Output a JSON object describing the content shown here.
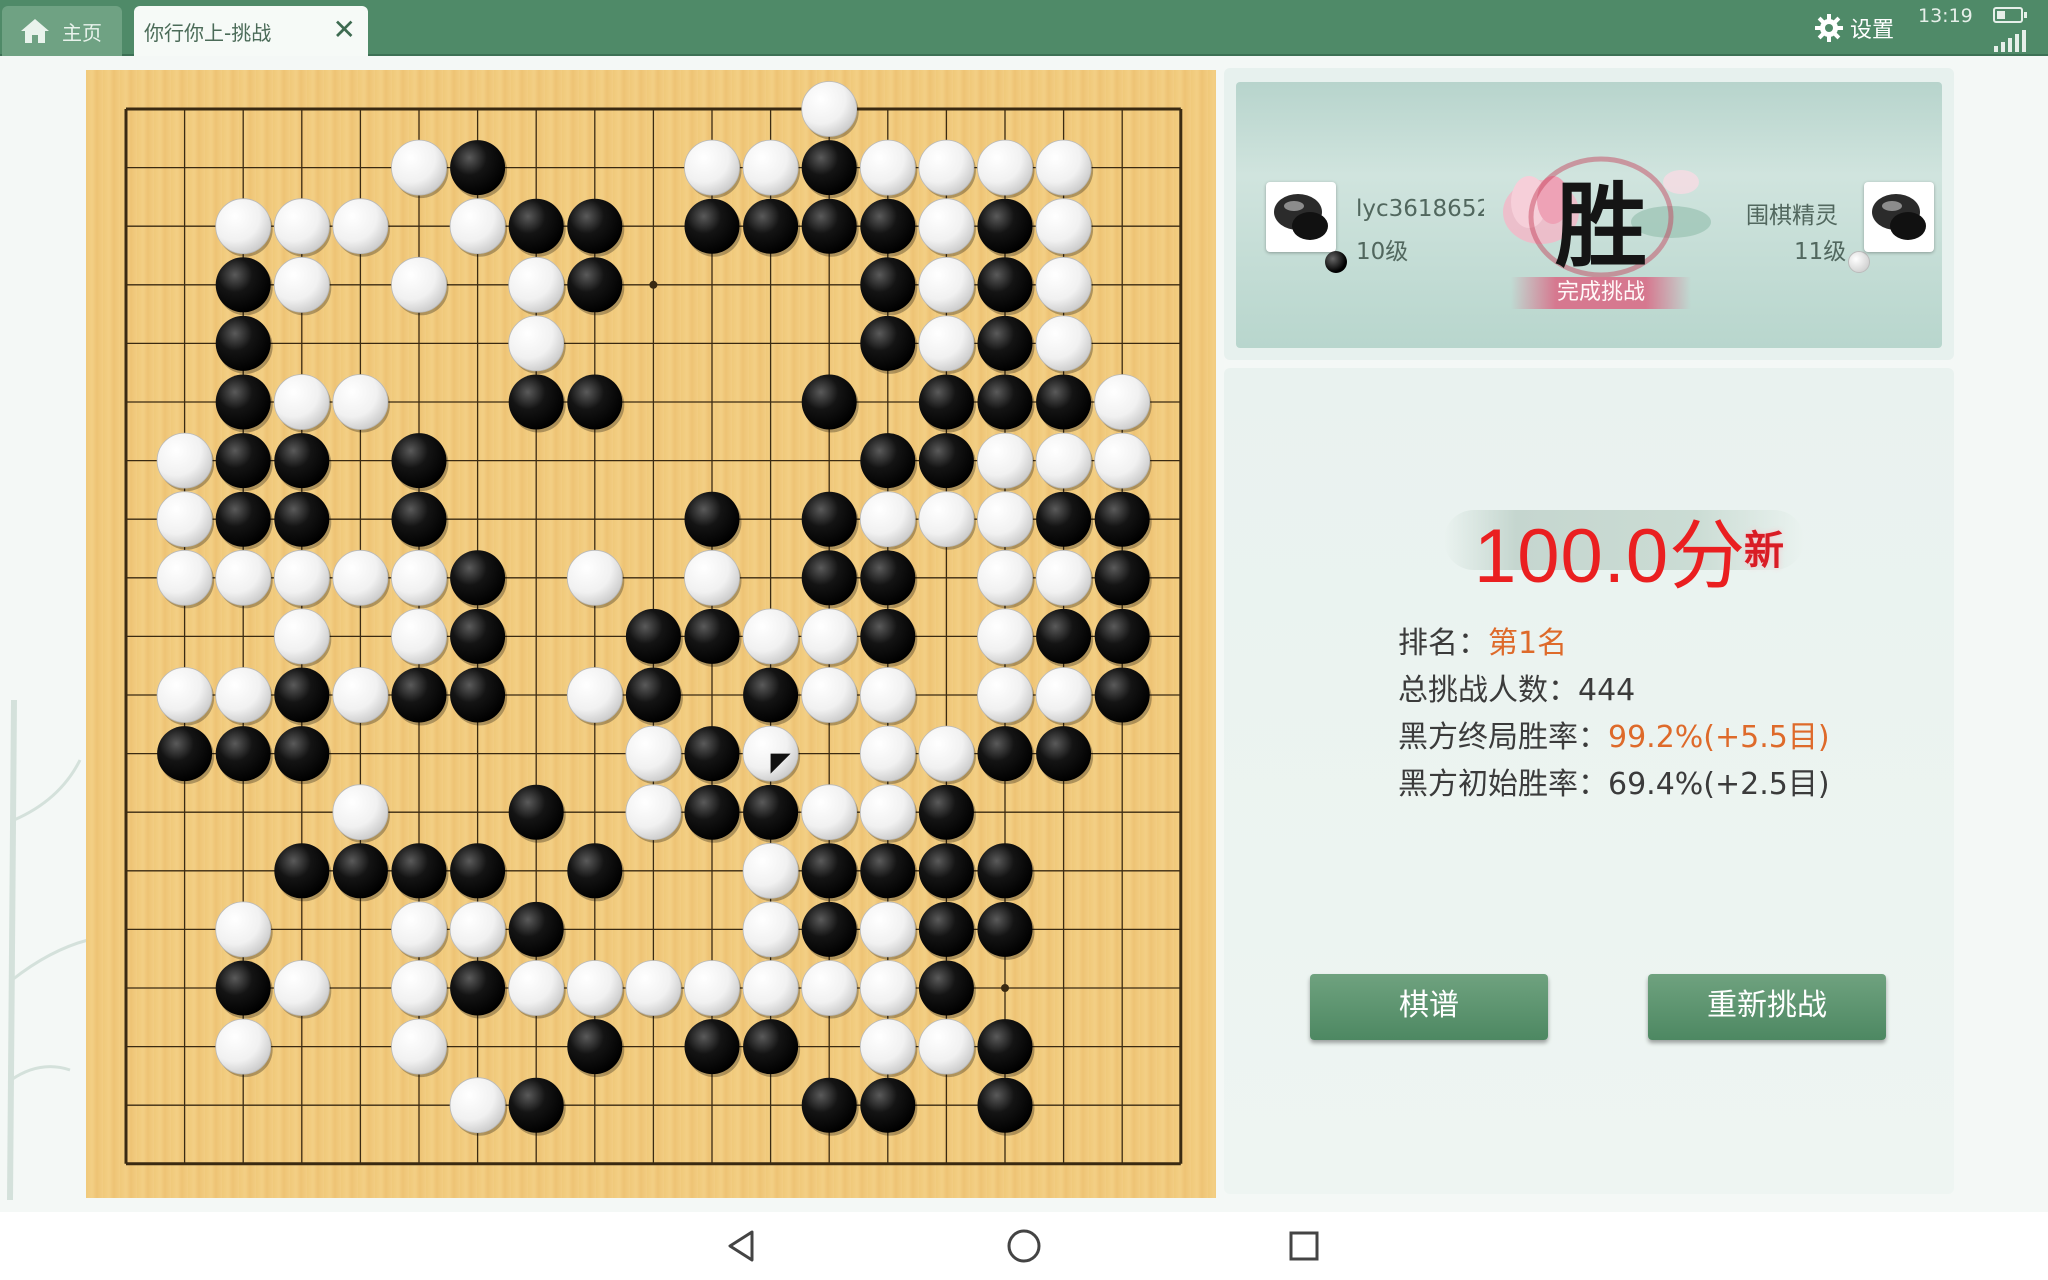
{
  "topbar": {
    "home_tab_label": "主页",
    "challenge_tab_label": "你行你上-挑战",
    "close_symbol": "✕",
    "settings_label": "设置",
    "clock": "13:19",
    "icons": [
      "home-icon",
      "close-icon",
      "gear-icon",
      "battery-icon",
      "signal-icon"
    ]
  },
  "board": {
    "size": 19,
    "colors": {
      "wood": "#f0c97a",
      "line": "#3a2a12",
      "black_stone": "#111111",
      "white_stone": "#f5f5f5"
    },
    "last_move_marker": "black-triangle",
    "rows": [
      "...........W.......",
      "....WB...WWBWWWW...",
      "..WWWWBB.BBBBWBW...",
      "..BW.W.WB.....BWBW.",
      "..B......W.....BWBW",
      "..BWW.....BB..B.BBBW",
      ".WBB.B........BBWWW",
      ".WBB.B....B.BWWWBBB",
      ".WWWWWBW.W.BB.WWB.",
      "...W.WB..BBWWB..WBB",
      ".WWBWBB.WB.BWW..WWB",
      ".BBB.......WB.WWBB.",
      "....W..B..W.BBWWB..",
      "...BBBB.B...WBBBB..",
      "..W..WWB....WBWBB..",
      "..BW..WBWWWWWWWB...",
      "..W..W...B..BB.WWB.",
      ".......WB.....BB.B.",
      "..................."
    ],
    "stones": [
      {
        "c": "W",
        "x": 12,
        "y": 0
      },
      {
        "c": "W",
        "x": 5,
        "y": 1
      },
      {
        "c": "B",
        "x": 6,
        "y": 1
      },
      {
        "c": "W",
        "x": 10,
        "y": 1
      },
      {
        "c": "W",
        "x": 11,
        "y": 1
      },
      {
        "c": "B",
        "x": 12,
        "y": 1
      },
      {
        "c": "W",
        "x": 13,
        "y": 1
      },
      {
        "c": "W",
        "x": 14,
        "y": 1
      },
      {
        "c": "W",
        "x": 15,
        "y": 1
      },
      {
        "c": "W",
        "x": 16,
        "y": 1
      },
      {
        "c": "W",
        "x": 2,
        "y": 2
      },
      {
        "c": "W",
        "x": 3,
        "y": 2
      },
      {
        "c": "W",
        "x": 4,
        "y": 2
      },
      {
        "c": "W",
        "x": 6,
        "y": 2
      },
      {
        "c": "B",
        "x": 7,
        "y": 2
      },
      {
        "c": "B",
        "x": 8,
        "y": 2
      },
      {
        "c": "B",
        "x": 10,
        "y": 2
      },
      {
        "c": "B",
        "x": 11,
        "y": 2
      },
      {
        "c": "B",
        "x": 12,
        "y": 2
      },
      {
        "c": "B",
        "x": 13,
        "y": 2
      },
      {
        "c": "W",
        "x": 14,
        "y": 2
      },
      {
        "c": "B",
        "x": 15,
        "y": 2
      },
      {
        "c": "W",
        "x": 16,
        "y": 2
      },
      {
        "c": "B",
        "x": 2,
        "y": 3
      },
      {
        "c": "W",
        "x": 3,
        "y": 3
      },
      {
        "c": "W",
        "x": 5,
        "y": 3
      },
      {
        "c": "W",
        "x": 7,
        "y": 3
      },
      {
        "c": "B",
        "x": 8,
        "y": 3
      },
      {
        "c": "B",
        "x": 13,
        "y": 3
      },
      {
        "c": "W",
        "x": 14,
        "y": 3
      },
      {
        "c": "B",
        "x": 15,
        "y": 3
      },
      {
        "c": "W",
        "x": 16,
        "y": 3
      },
      {
        "c": "B",
        "x": 2,
        "y": 4
      },
      {
        "c": "W",
        "x": 7,
        "y": 4
      },
      {
        "c": "B",
        "x": 13,
        "y": 4
      },
      {
        "c": "W",
        "x": 14,
        "y": 4
      },
      {
        "c": "B",
        "x": 15,
        "y": 4
      },
      {
        "c": "W",
        "x": 16,
        "y": 4
      },
      {
        "c": "B",
        "x": 2,
        "y": 5
      },
      {
        "c": "W",
        "x": 3,
        "y": 5
      },
      {
        "c": "W",
        "x": 4,
        "y": 5
      },
      {
        "c": "B",
        "x": 7,
        "y": 5
      },
      {
        "c": "B",
        "x": 8,
        "y": 5
      },
      {
        "c": "B",
        "x": 12,
        "y": 5
      },
      {
        "c": "B",
        "x": 14,
        "y": 5
      },
      {
        "c": "B",
        "x": 15,
        "y": 5
      },
      {
        "c": "B",
        "x": 16,
        "y": 5
      },
      {
        "c": "W",
        "x": 17,
        "y": 5
      },
      {
        "c": "W",
        "x": 1,
        "y": 6
      },
      {
        "c": "B",
        "x": 2,
        "y": 6
      },
      {
        "c": "B",
        "x": 3,
        "y": 6
      },
      {
        "c": "B",
        "x": 5,
        "y": 6
      },
      {
        "c": "B",
        "x": 13,
        "y": 6
      },
      {
        "c": "B",
        "x": 14,
        "y": 6
      },
      {
        "c": "W",
        "x": 15,
        "y": 6
      },
      {
        "c": "W",
        "x": 16,
        "y": 6
      },
      {
        "c": "W",
        "x": 17,
        "y": 6
      },
      {
        "c": "W",
        "x": 1,
        "y": 7
      },
      {
        "c": "B",
        "x": 2,
        "y": 7
      },
      {
        "c": "B",
        "x": 3,
        "y": 7
      },
      {
        "c": "B",
        "x": 5,
        "y": 7
      },
      {
        "c": "B",
        "x": 10,
        "y": 7
      },
      {
        "c": "B",
        "x": 12,
        "y": 7
      },
      {
        "c": "W",
        "x": 13,
        "y": 7
      },
      {
        "c": "W",
        "x": 14,
        "y": 7
      },
      {
        "c": "W",
        "x": 15,
        "y": 7
      },
      {
        "c": "B",
        "x": 16,
        "y": 7
      },
      {
        "c": "B",
        "x": 17,
        "y": 7
      },
      {
        "c": "W",
        "x": 1,
        "y": 8
      },
      {
        "c": "W",
        "x": 2,
        "y": 8
      },
      {
        "c": "W",
        "x": 3,
        "y": 8
      },
      {
        "c": "W",
        "x": 4,
        "y": 8
      },
      {
        "c": "W",
        "x": 5,
        "y": 8
      },
      {
        "c": "B",
        "x": 6,
        "y": 8
      },
      {
        "c": "W",
        "x": 8,
        "y": 8
      },
      {
        "c": "W",
        "x": 10,
        "y": 8
      },
      {
        "c": "B",
        "x": 12,
        "y": 8
      },
      {
        "c": "B",
        "x": 13,
        "y": 8
      },
      {
        "c": "W",
        "x": 15,
        "y": 8
      },
      {
        "c": "W",
        "x": 16,
        "y": 8
      },
      {
        "c": "B",
        "x": 17,
        "y": 8
      },
      {
        "c": "W",
        "x": 3,
        "y": 9
      },
      {
        "c": "W",
        "x": 5,
        "y": 9
      },
      {
        "c": "B",
        "x": 6,
        "y": 9
      },
      {
        "c": "B",
        "x": 9,
        "y": 9
      },
      {
        "c": "B",
        "x": 10,
        "y": 9
      },
      {
        "c": "W",
        "x": 11,
        "y": 9
      },
      {
        "c": "W",
        "x": 12,
        "y": 9
      },
      {
        "c": "B",
        "x": 13,
        "y": 9
      },
      {
        "c": "W",
        "x": 15,
        "y": 9
      },
      {
        "c": "B",
        "x": 16,
        "y": 9
      },
      {
        "c": "B",
        "x": 17,
        "y": 9
      },
      {
        "c": "W",
        "x": 1,
        "y": 10
      },
      {
        "c": "W",
        "x": 2,
        "y": 10
      },
      {
        "c": "B",
        "x": 3,
        "y": 10
      },
      {
        "c": "W",
        "x": 4,
        "y": 10
      },
      {
        "c": "B",
        "x": 5,
        "y": 10
      },
      {
        "c": "B",
        "x": 6,
        "y": 10
      },
      {
        "c": "W",
        "x": 8,
        "y": 10
      },
      {
        "c": "B",
        "x": 9,
        "y": 10
      },
      {
        "c": "B",
        "x": 11,
        "y": 10
      },
      {
        "c": "W",
        "x": 12,
        "y": 10
      },
      {
        "c": "W",
        "x": 13,
        "y": 10
      },
      {
        "c": "W",
        "x": 15,
        "y": 10
      },
      {
        "c": "W",
        "x": 16,
        "y": 10
      },
      {
        "c": "B",
        "x": 17,
        "y": 10
      },
      {
        "c": "B",
        "x": 1,
        "y": 11
      },
      {
        "c": "B",
        "x": 2,
        "y": 11
      },
      {
        "c": "B",
        "x": 3,
        "y": 11
      },
      {
        "c": "W",
        "x": 9,
        "y": 11
      },
      {
        "c": "B",
        "x": 10,
        "y": 11
      },
      {
        "c": "W",
        "x": 11,
        "y": 11
      },
      {
        "c": "W",
        "x": 13,
        "y": 11
      },
      {
        "c": "W",
        "x": 14,
        "y": 11
      },
      {
        "c": "B",
        "x": 15,
        "y": 11
      },
      {
        "c": "B",
        "x": 16,
        "y": 11
      },
      {
        "c": "W",
        "x": 4,
        "y": 12
      },
      {
        "c": "B",
        "x": 7,
        "y": 12
      },
      {
        "c": "W",
        "x": 9,
        "y": 12
      },
      {
        "c": "B",
        "x": 10,
        "y": 12
      },
      {
        "c": "B",
        "x": 11,
        "y": 12
      },
      {
        "c": "W",
        "x": 12,
        "y": 12
      },
      {
        "c": "W",
        "x": 13,
        "y": 12
      },
      {
        "c": "B",
        "x": 14,
        "y": 12
      },
      {
        "c": "B",
        "x": 3,
        "y": 13
      },
      {
        "c": "B",
        "x": 4,
        "y": 13
      },
      {
        "c": "B",
        "x": 5,
        "y": 13
      },
      {
        "c": "B",
        "x": 6,
        "y": 13
      },
      {
        "c": "B",
        "x": 8,
        "y": 13
      },
      {
        "c": "W",
        "x": 11,
        "y": 13
      },
      {
        "c": "B",
        "x": 12,
        "y": 13
      },
      {
        "c": "B",
        "x": 13,
        "y": 13
      },
      {
        "c": "B",
        "x": 14,
        "y": 13
      },
      {
        "c": "B",
        "x": 15,
        "y": 13
      },
      {
        "c": "W",
        "x": 2,
        "y": 14
      },
      {
        "c": "W",
        "x": 5,
        "y": 14
      },
      {
        "c": "W",
        "x": 6,
        "y": 14
      },
      {
        "c": "B",
        "x": 7,
        "y": 14
      },
      {
        "c": "W",
        "x": 11,
        "y": 14
      },
      {
        "c": "B",
        "x": 12,
        "y": 14
      },
      {
        "c": "W",
        "x": 13,
        "y": 14
      },
      {
        "c": "B",
        "x": 14,
        "y": 14
      },
      {
        "c": "B",
        "x": 15,
        "y": 14
      },
      {
        "c": "B",
        "x": 2,
        "y": 15
      },
      {
        "c": "W",
        "x": 3,
        "y": 15
      },
      {
        "c": "W",
        "x": 5,
        "y": 15
      },
      {
        "c": "B",
        "x": 6,
        "y": 15
      },
      {
        "c": "W",
        "x": 7,
        "y": 15
      },
      {
        "c": "W",
        "x": 8,
        "y": 15
      },
      {
        "c": "W",
        "x": 9,
        "y": 15
      },
      {
        "c": "W",
        "x": 10,
        "y": 15
      },
      {
        "c": "W",
        "x": 11,
        "y": 15
      },
      {
        "c": "W",
        "x": 12,
        "y": 15
      },
      {
        "c": "W",
        "x": 13,
        "y": 15
      },
      {
        "c": "B",
        "x": 14,
        "y": 15
      },
      {
        "c": "W",
        "x": 2,
        "y": 16
      },
      {
        "c": "W",
        "x": 5,
        "y": 16
      },
      {
        "c": "B",
        "x": 8,
        "y": 16
      },
      {
        "c": "B",
        "x": 10,
        "y": 16
      },
      {
        "c": "B",
        "x": 11,
        "y": 16
      },
      {
        "c": "W",
        "x": 13,
        "y": 16
      },
      {
        "c": "W",
        "x": 14,
        "y": 16
      },
      {
        "c": "B",
        "x": 15,
        "y": 16
      },
      {
        "c": "W",
        "x": 6,
        "y": 17
      },
      {
        "c": "B",
        "x": 7,
        "y": 17
      },
      {
        "c": "B",
        "x": 12,
        "y": 17
      },
      {
        "c": "B",
        "x": 13,
        "y": 17
      },
      {
        "c": "B",
        "x": 15,
        "y": 17
      }
    ],
    "last_move": {
      "x": 11,
      "y": 11
    }
  },
  "result": {
    "win_char": "胜",
    "win_subtitle": "完成挑战",
    "player_black": {
      "name": "lyc3618652",
      "level": "10级"
    },
    "player_white": {
      "name": "围棋精灵",
      "level": "11级"
    }
  },
  "stats": {
    "score": "100.0分",
    "new_badge": "新",
    "rank_label": "排名：",
    "rank_value": "第1名",
    "total_label": "总挑战人数：",
    "total_value": "444",
    "final_label": "黑方终局胜率：",
    "final_value": "99.2%(+5.5目)",
    "initial_label": "黑方初始胜率：",
    "initial_value": "69.4%(+2.5目)",
    "colors": {
      "score": "#ea1f20",
      "highlight": "#de6a2a",
      "button": "#5a9470"
    }
  },
  "buttons": {
    "record_label": "棋谱",
    "retry_label": "重新挑战"
  },
  "navbar": {
    "icons": [
      "back-triangle-icon",
      "home-circle-icon",
      "recent-square-icon"
    ]
  }
}
